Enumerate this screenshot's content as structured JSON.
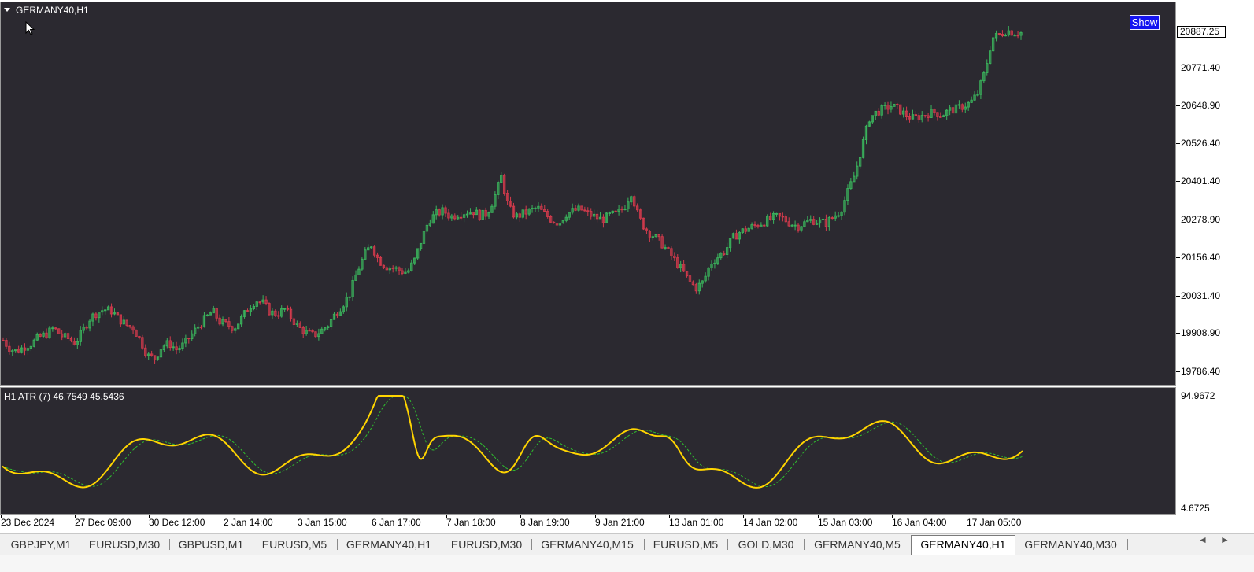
{
  "chart": {
    "title": "GERMANY40,H1",
    "show_label": "Show",
    "current_price": "20887.25",
    "price_scale": [
      "20771.40",
      "20648.90",
      "20526.40",
      "20401.40",
      "20278.90",
      "20156.40",
      "20031.40",
      "19908.90",
      "19786.40"
    ],
    "candle_colors": {
      "up": "#3ab45c",
      "down": "#d23a4c",
      "background": "#2b2930"
    },
    "price_path": [
      19890,
      19860,
      19855,
      19870,
      19880,
      19900,
      19910,
      19930,
      19905,
      19895,
      19880,
      19920,
      19960,
      19980,
      19990,
      19985,
      19960,
      19940,
      19930,
      19890,
      19840,
      19830,
      19870,
      19880,
      19860,
      19875,
      19905,
      19935,
      19960,
      19985,
      19950,
      19940,
      19930,
      19960,
      19995,
      20020,
      20010,
      19980,
      19975,
      19990,
      19960,
      19930,
      19915,
      19905,
      19920,
      19940,
      19975,
      20005,
      20040,
      20110,
      20165,
      20200,
      20150,
      20130,
      20125,
      20115,
      20110,
      20150,
      20220,
      20280,
      20300,
      20310,
      20290,
      20300,
      20305,
      20310,
      20295,
      20300,
      20350,
      20420,
      20320,
      20290,
      20300,
      20310,
      20320,
      20300,
      20280,
      20270,
      20300,
      20310,
      20315,
      20300,
      20290,
      20280,
      20295,
      20300,
      20320,
      20370,
      20290,
      20250,
      20230,
      20210,
      20180,
      20150,
      20120,
      20080,
      20060,
      20080,
      20140,
      20160,
      20180,
      20220,
      20240,
      20250,
      20260,
      20270,
      20280,
      20290,
      20285,
      20270,
      20260,
      20270,
      20280,
      20275,
      20270,
      20290,
      20310,
      20370,
      20430,
      20520,
      20610,
      20630,
      20640,
      20650,
      20640,
      20620,
      20610,
      20615,
      20625,
      20630,
      20620,
      20635,
      20640,
      20650,
      20660,
      20690,
      20760,
      20870,
      20880,
      20895,
      20888,
      20887
    ]
  },
  "indicator": {
    "title": "H1  ATR (7) 46.7549 45.5436",
    "scale_top": "94.9672",
    "scale_bottom": "4.6725",
    "line_color": "#ffd400",
    "signal_color": "#2fbf2f"
  },
  "time_axis": [
    "23 Dec 2024",
    "27 Dec 09:00",
    "30 Dec 12:00",
    "2 Jan 14:00",
    "3 Jan 15:00",
    "6 Jan 17:00",
    "7 Jan 18:00",
    "8 Jan 19:00",
    "9 Jan 21:00",
    "13 Jan 01:00",
    "14 Jan 02:00",
    "15 Jan 03:00",
    "16 Jan 04:00",
    "17 Jan 05:00"
  ],
  "tabs": [
    {
      "label": "GBPJPY,M1",
      "active": false
    },
    {
      "label": "EURUSD,M30",
      "active": false
    },
    {
      "label": "GBPUSD,M1",
      "active": false
    },
    {
      "label": "EURUSD,M5",
      "active": false
    },
    {
      "label": "GERMANY40,H1",
      "active": false
    },
    {
      "label": "EURUSD,M30",
      "active": false
    },
    {
      "label": "GERMANY40,M15",
      "active": false
    },
    {
      "label": "EURUSD,M5",
      "active": false
    },
    {
      "label": "GOLD,M30",
      "active": false
    },
    {
      "label": "GERMANY40,M5",
      "active": false
    },
    {
      "label": "GERMANY40,H1",
      "active": true
    },
    {
      "label": "GERMANY40,M30",
      "active": false
    }
  ],
  "tab_scroll": {
    "left": "◄",
    "right": "►"
  }
}
